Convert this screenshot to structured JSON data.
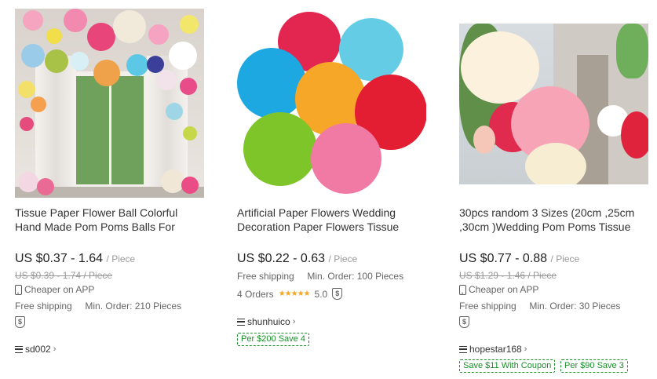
{
  "products": [
    {
      "title_line1": "Tissue Paper Flower Ball Colorful",
      "title_line2": "Hand Made Pom Poms Balls For",
      "price": "US $0.37 - 1.64",
      "price_unit": "/ Piece",
      "original_price": "US $0.39 - 1.74 / Piece",
      "app_text": "Cheaper on APP",
      "shipping": "Free shipping",
      "min_order": "Min. Order: 210 Pieces",
      "store": "sd002"
    },
    {
      "title_line1": "Artificial Paper Flowers Wedding",
      "title_line2": "Decoration Paper Flowers Tissue",
      "price": "US $0.22 - 0.63",
      "price_unit": "/ Piece",
      "shipping": "Free shipping",
      "min_order": "Min. Order: 100 Pieces",
      "orders": "4 Orders",
      "rating": "5.0",
      "store": "shunhuico",
      "coupons": [
        "Per $200 Save 4"
      ]
    },
    {
      "title_line1": "30pcs random 3 Sizes (20cm ,25cm",
      "title_line2": ",30cm )Wedding Pom Poms Tissue",
      "price": "US $0.77 - 0.88",
      "price_unit": "/ Piece",
      "original_price": "US $1.29 - 1.46 / Piece",
      "app_text": "Cheaper on APP",
      "shipping": "Free shipping",
      "min_order": "Min. Order: 30 Pieces",
      "store": "hopestar168",
      "coupons": [
        "Save $11 With Coupon",
        "Per $90 Save 3"
      ]
    }
  ],
  "icons": {
    "stars": "★★★★★",
    "shield": "$",
    "chevron": "›"
  },
  "colors": {
    "coupon_green": "#1a8f2a",
    "star": "#f5a623"
  }
}
